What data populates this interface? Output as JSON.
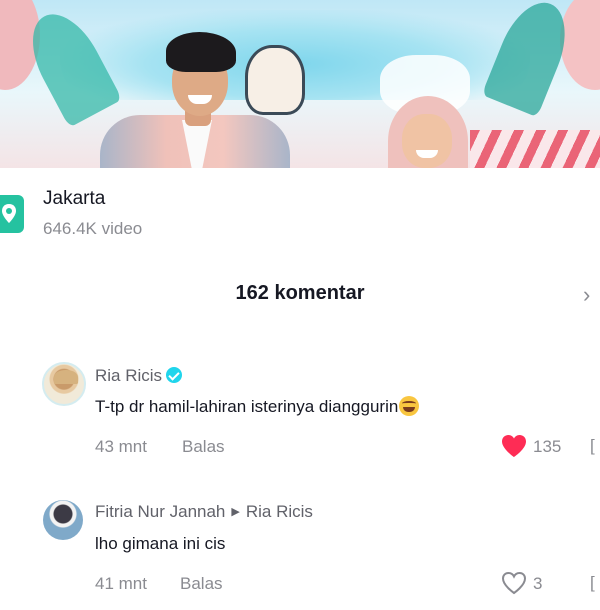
{
  "location": {
    "name": "Jakarta",
    "video_count": "646.4K video",
    "icon": "location-pin-icon",
    "icon_color": "#25c2a0"
  },
  "comments_header": {
    "title": "162 komentar"
  },
  "comments": [
    {
      "author": "Ria Ricis",
      "verified": true,
      "text": "T-tp dr hamil-lahiran isterinya dianggurin",
      "emoji": "laughing-emoji",
      "time": "43 mnt",
      "reply_label": "Balas",
      "likes": "135",
      "liked": true,
      "like_color": "#fe2c55"
    },
    {
      "author": "Fitria Nur Jannah",
      "reply_to": "Ria Ricis",
      "text": "lho gimana ini cis",
      "time": "41 mnt",
      "reply_label": "Balas",
      "likes": "3",
      "liked": false
    }
  ]
}
